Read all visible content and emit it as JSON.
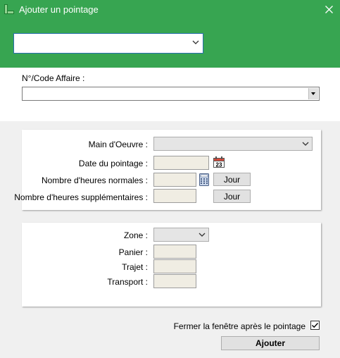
{
  "window": {
    "title": "Ajouter un pointage"
  },
  "affaire": {
    "label": "N°/Code Affaire :",
    "value": ""
  },
  "top_select": {
    "value": ""
  },
  "panel1": {
    "main_oeuvre_label": "Main d'Oeuvre :",
    "date_label": "Date du pointage :",
    "heures_normales_label": "Nombre d'heures normales :",
    "heures_supp_label": "Nombre d'heures supplémentaires :",
    "jour_button_1": "Jour",
    "jour_button_2": "Jour",
    "calendar_day": "23"
  },
  "panel2": {
    "zone_label": "Zone :",
    "panier_label": "Panier :",
    "trajet_label": "Trajet :",
    "transport_label": "Transport :"
  },
  "footer": {
    "close_after_label": "Fermer la fenêtre après le pointage",
    "close_after_checked": true,
    "submit_label": "Ajouter"
  },
  "colors": {
    "accent": "#37a551",
    "focus": "#2a6fb0"
  },
  "icons": [
    "app-icon",
    "close-icon",
    "chevron-down-icon",
    "calendar-icon",
    "calculator-icon",
    "checkmark-icon"
  ]
}
